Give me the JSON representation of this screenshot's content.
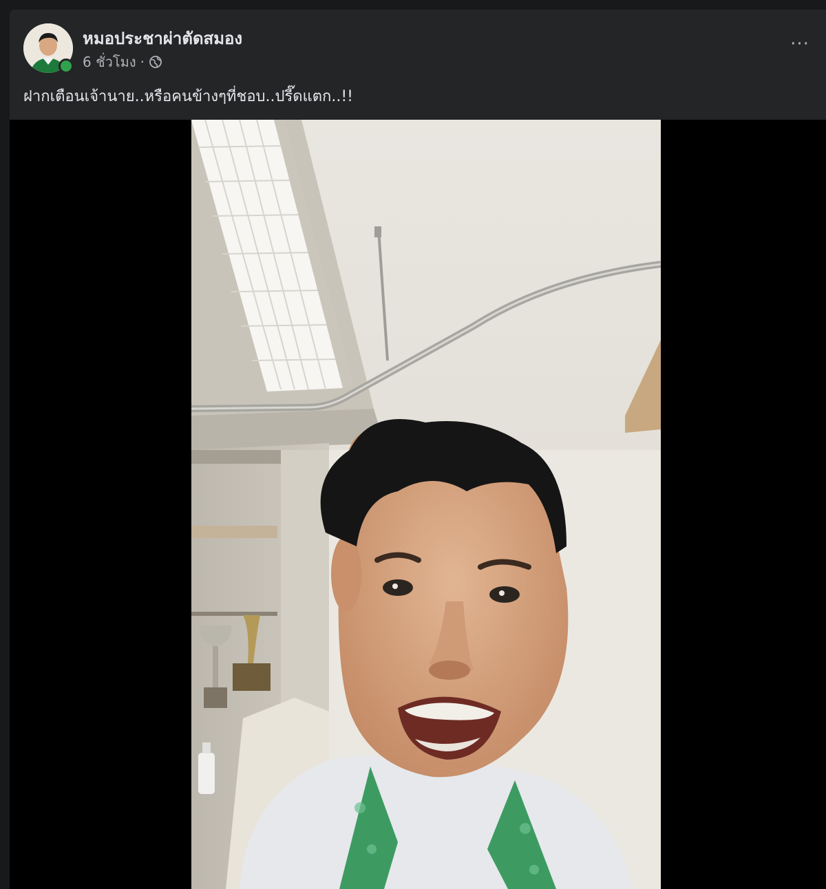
{
  "post": {
    "author_name": "หมอประชาผ่าตัดสมอง",
    "timestamp": "6 ชั่วโมง",
    "separator": "·",
    "audience_icon": "globe-icon",
    "more_icon": "more-options-icon",
    "more_label": "···",
    "caption": "ฝากเตือนเจ้านาย..หรือคนข้างๆที่ชอบ..ปรี๊ดแตก..!!"
  },
  "video": {
    "subject": "video-thumbnail"
  },
  "colors": {
    "background": "#18191a",
    "card": "#242526",
    "text_primary": "#e4e6eb",
    "text_secondary": "#b0b3b8",
    "online": "#31a24c"
  }
}
